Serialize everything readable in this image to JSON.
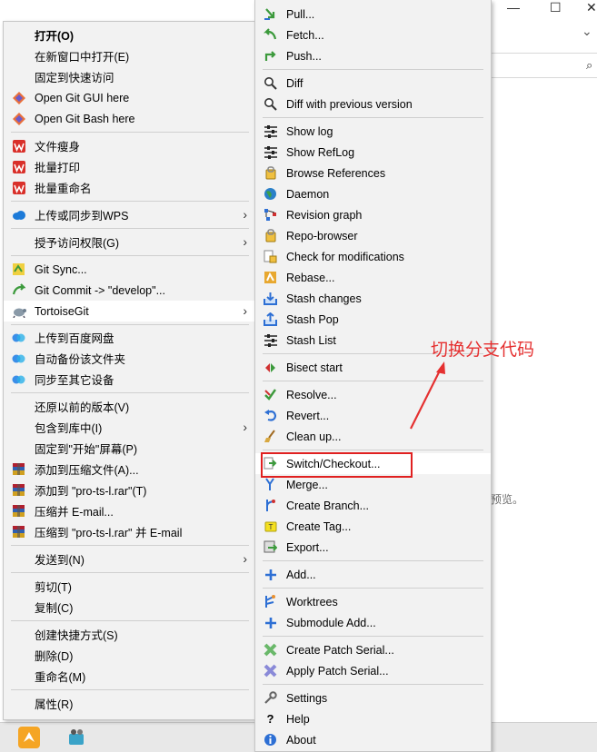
{
  "colors": {
    "menu_bg": "#f2f2f2",
    "highlight_box": "#e02020",
    "annotation": "#e53030",
    "wps_red": "#d9302a",
    "onedrive_blue": "#1c7ad8",
    "git_green": "#3c9a3c",
    "git_blue": "#2d6fd4",
    "winrar_red": "#b0202e"
  },
  "background": {
    "minimize_icon": "—",
    "maximize_icon": "☐",
    "close_icon": "✕",
    "chevron_icon": "⌄",
    "search_icon": "⌕",
    "preview_text": "预览。"
  },
  "context_menu": {
    "items": [
      {
        "label": "打开(O)",
        "icon": "none"
      },
      {
        "label": "在新窗口中打开(E)",
        "icon": "none"
      },
      {
        "label": "固定到快速访问",
        "icon": "none"
      },
      {
        "label": "Open Git GUI here",
        "icon": "git-diamond-icon"
      },
      {
        "label": "Open Git Bash here",
        "icon": "git-diamond-icon"
      },
      {
        "label": "文件瘦身",
        "icon": "wps-icon"
      },
      {
        "label": "批量打印",
        "icon": "wps-icon"
      },
      {
        "label": "批量重命名",
        "icon": "wps-icon"
      },
      {
        "label": "上传或同步到WPS",
        "icon": "cloud-icon",
        "submenu": true
      },
      {
        "label": "授予访问权限(G)",
        "icon": "none",
        "submenu": true
      },
      {
        "label": "Git Sync...",
        "icon": "git-sync-icon"
      },
      {
        "label": "Git Commit -> \"develop\"...",
        "icon": "git-commit-icon"
      },
      {
        "label": "TortoiseGit",
        "icon": "tortoisegit-icon",
        "submenu": true
      },
      {
        "label": "上传到百度网盘",
        "icon": "baidu-icon"
      },
      {
        "label": "自动备份该文件夹",
        "icon": "baidu-icon"
      },
      {
        "label": "同步至其它设备",
        "icon": "baidu-icon"
      },
      {
        "label": "还原以前的版本(V)",
        "icon": "none"
      },
      {
        "label": "包含到库中(I)",
        "icon": "none",
        "submenu": true
      },
      {
        "label": "固定到\"开始\"屏幕(P)",
        "icon": "none"
      },
      {
        "label": "添加到压缩文件(A)...",
        "icon": "winrar-icon"
      },
      {
        "label": "添加到 \"pro-ts-l.rar\"(T)",
        "icon": "winrar-icon"
      },
      {
        "label": "压缩并 E-mail...",
        "icon": "winrar-icon"
      },
      {
        "label": "压缩到 \"pro-ts-l.rar\" 并 E-mail",
        "icon": "winrar-icon"
      },
      {
        "label": "发送到(N)",
        "icon": "none",
        "submenu": true
      },
      {
        "label": "剪切(T)",
        "icon": "none"
      },
      {
        "label": "复制(C)",
        "icon": "none"
      },
      {
        "label": "创建快捷方式(S)",
        "icon": "none"
      },
      {
        "label": "删除(D)",
        "icon": "none"
      },
      {
        "label": "重命名(M)",
        "icon": "none"
      },
      {
        "label": "属性(R)",
        "icon": "none"
      }
    ]
  },
  "tortoisegit_menu": {
    "items": [
      {
        "label": "Pull...",
        "icon": "pull-icon"
      },
      {
        "label": "Fetch...",
        "icon": "fetch-icon"
      },
      {
        "label": "Push...",
        "icon": "push-icon"
      },
      {
        "label": "Diff",
        "icon": "diff-icon"
      },
      {
        "label": "Diff with previous version",
        "icon": "diff-icon"
      },
      {
        "label": "Show log",
        "icon": "log-icon"
      },
      {
        "label": "Show RefLog",
        "icon": "log-icon"
      },
      {
        "label": "Browse References",
        "icon": "references-icon"
      },
      {
        "label": "Daemon",
        "icon": "globe-icon"
      },
      {
        "label": "Revision graph",
        "icon": "graph-icon"
      },
      {
        "label": "Repo-browser",
        "icon": "repo-icon"
      },
      {
        "label": "Check for modifications",
        "icon": "check-icon"
      },
      {
        "label": "Rebase...",
        "icon": "rebase-icon"
      },
      {
        "label": "Stash changes",
        "icon": "stash-icon"
      },
      {
        "label": "Stash Pop",
        "icon": "stash-pop-icon"
      },
      {
        "label": "Stash List",
        "icon": "log-icon"
      },
      {
        "label": "Bisect start",
        "icon": "bisect-icon"
      },
      {
        "label": "Resolve...",
        "icon": "resolve-icon"
      },
      {
        "label": "Revert...",
        "icon": "revert-icon"
      },
      {
        "label": "Clean up...",
        "icon": "broom-icon"
      },
      {
        "label": "Switch/Checkout...",
        "icon": "switch-icon"
      },
      {
        "label": "Merge...",
        "icon": "merge-icon"
      },
      {
        "label": "Create Branch...",
        "icon": "branch-icon"
      },
      {
        "label": "Create Tag...",
        "icon": "tag-icon"
      },
      {
        "label": "Export...",
        "icon": "export-icon"
      },
      {
        "label": "Add...",
        "icon": "add-icon"
      },
      {
        "label": "Worktrees",
        "icon": "worktree-icon"
      },
      {
        "label": "Submodule Add...",
        "icon": "add-icon"
      },
      {
        "label": "Create Patch Serial...",
        "icon": "patch-icon"
      },
      {
        "label": "Apply Patch Serial...",
        "icon": "patch-icon"
      },
      {
        "label": "Settings",
        "icon": "settings-icon"
      },
      {
        "label": "Help",
        "icon": "help-icon"
      },
      {
        "label": "About",
        "icon": "about-icon"
      }
    ]
  },
  "annotation": {
    "text": "切换分支代码"
  }
}
